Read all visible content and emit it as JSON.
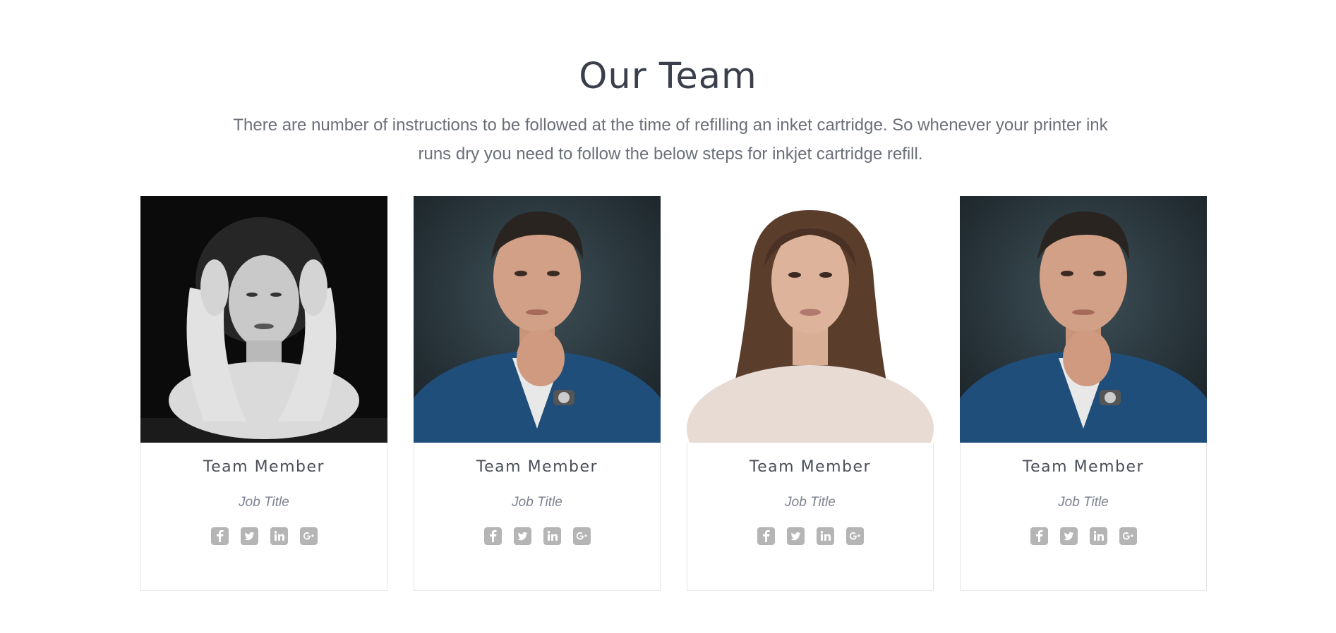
{
  "section": {
    "title": "Our Team",
    "intro": "There are number of instructions to be followed at the time of refilling an inket cartridge. So whenever your printer ink runs dry you need to follow the below steps for inkjet cartridge refill."
  },
  "team": [
    {
      "name": "Team Member",
      "job_title": "Job Title",
      "photo": "woman-black-and-white-portrait"
    },
    {
      "name": "Team Member",
      "job_title": "Job Title",
      "photo": "man-blue-suit-portrait"
    },
    {
      "name": "Team Member",
      "job_title": "Job Title",
      "photo": "woman-long-hair-portrait"
    },
    {
      "name": "Team Member",
      "job_title": "Job Title",
      "photo": "man-blue-suit-portrait"
    }
  ],
  "social_icons": [
    "facebook-icon",
    "twitter-icon",
    "linkedin-icon",
    "google-plus-icon"
  ],
  "colors": {
    "heading": "#3a3f4b",
    "intro_text": "#6b6f78",
    "job_title": "#7d8290",
    "social_icon": "#b5b5b5",
    "card_border": "#e3e3e3"
  }
}
